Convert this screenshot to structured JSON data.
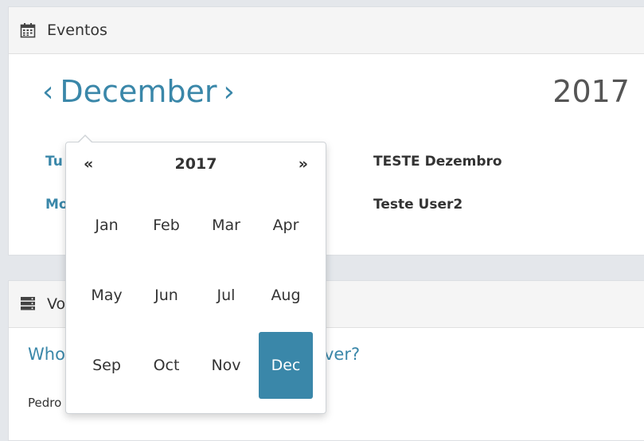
{
  "events_panel": {
    "title": "Eventos",
    "month": "December",
    "prev_arrow": "‹",
    "next_arrow": "›",
    "year": "2017",
    "rows": [
      {
        "link_partial": "Tu",
        "title": "TESTE Dezembro"
      },
      {
        "link_partial": "Mo",
        "title": "Teste User2"
      }
    ]
  },
  "vote_panel": {
    "title_partial": "Vo",
    "question_start": "Who",
    "question_end": "ver?",
    "answer_partial": "Pedro"
  },
  "datepicker": {
    "prev": "«",
    "year": "2017",
    "next": "»",
    "months": [
      "Jan",
      "Feb",
      "Mar",
      "Apr",
      "May",
      "Jun",
      "Jul",
      "Aug",
      "Sep",
      "Oct",
      "Nov",
      "Dec"
    ],
    "selected": "Dec"
  },
  "colors": {
    "accent": "#3a87a9",
    "background": "#e4e7eb"
  }
}
